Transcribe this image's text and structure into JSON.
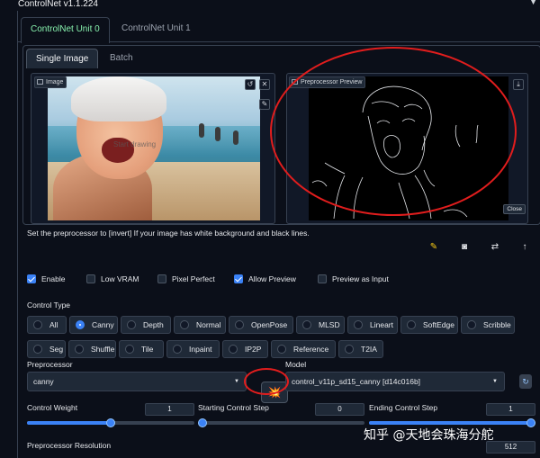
{
  "header": {
    "title": "ControlNet v1.1.224",
    "caret": "▼"
  },
  "unit_tabs": [
    {
      "label": "ControlNet Unit 0",
      "active": true
    },
    {
      "label": "ControlNet Unit 1",
      "active": false
    }
  ],
  "image_tabs": [
    {
      "label": "Single Image",
      "active": true
    },
    {
      "label": "Batch",
      "active": false
    }
  ],
  "image_panel": {
    "label": "Image",
    "overlay_text": "Start drawing"
  },
  "preview_panel": {
    "label": "Preprocessor Preview",
    "close_label": "Close"
  },
  "hint": "Set the preprocessor to [invert] If your image has white background and black lines.",
  "tool_icons": [
    "edit-icon",
    "camera-icon",
    "swap-icon",
    "send-up-icon"
  ],
  "checkboxes": [
    {
      "label": "Enable",
      "checked": true
    },
    {
      "label": "Low VRAM",
      "checked": false
    },
    {
      "label": "Pixel Perfect",
      "checked": false
    },
    {
      "label": "Allow Preview",
      "checked": true
    },
    {
      "label": "Preview as Input",
      "checked": false
    }
  ],
  "control_type": {
    "label": "Control Type",
    "options": [
      "All",
      "Canny",
      "Depth",
      "Normal",
      "OpenPose",
      "MLSD",
      "Lineart",
      "SoftEdge",
      "Scribble",
      "Seg",
      "Shuffle",
      "Tile",
      "Inpaint",
      "IP2P",
      "Reference",
      "T2IA"
    ],
    "selected": "Canny"
  },
  "preprocessor": {
    "label": "Preprocessor",
    "value": "canny",
    "run_icon": "💥"
  },
  "model": {
    "label": "Model",
    "value": "control_v11p_sd15_canny [d14c016b]",
    "refresh_icon": "↻"
  },
  "sliders": {
    "control_weight": {
      "label": "Control Weight",
      "value": "1",
      "fraction": 0.5
    },
    "starting_step": {
      "label": "Starting Control Step",
      "value": "0",
      "fraction": 0.0
    },
    "ending_step": {
      "label": "Ending Control Step",
      "value": "1",
      "fraction": 1.0
    }
  },
  "preprocessor_resolution": {
    "label": "Preprocessor Resolution",
    "value": "512"
  },
  "watermark": "知乎 @天地会珠海分舵",
  "accent_color": "#3b82f6",
  "annotation_color": "#e11d1d"
}
